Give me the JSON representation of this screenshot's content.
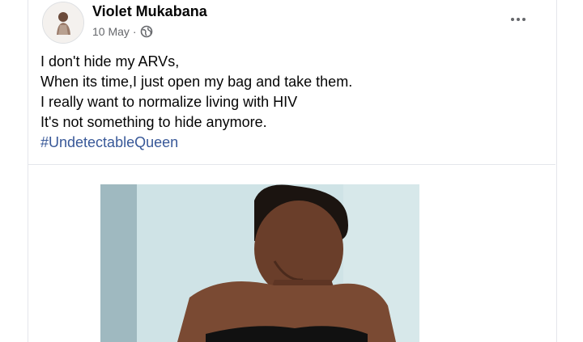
{
  "post": {
    "author": "Violet Mukabana",
    "date": "10 May",
    "separator": "·",
    "privacy_icon": "globe-icon",
    "more_icon": "more-options-icon",
    "lines": [
      "I don't hide my ARVs,",
      "When its time,I just open my bag and take them.",
      "I really want to normalize living with HIV",
      "It's not something to hide anymore."
    ],
    "hashtag": "#UndetectableQueen"
  },
  "colors": {
    "author": "#050505",
    "meta": "#65676b",
    "hashtag": "#385898",
    "divider": "#e4e6eb"
  }
}
